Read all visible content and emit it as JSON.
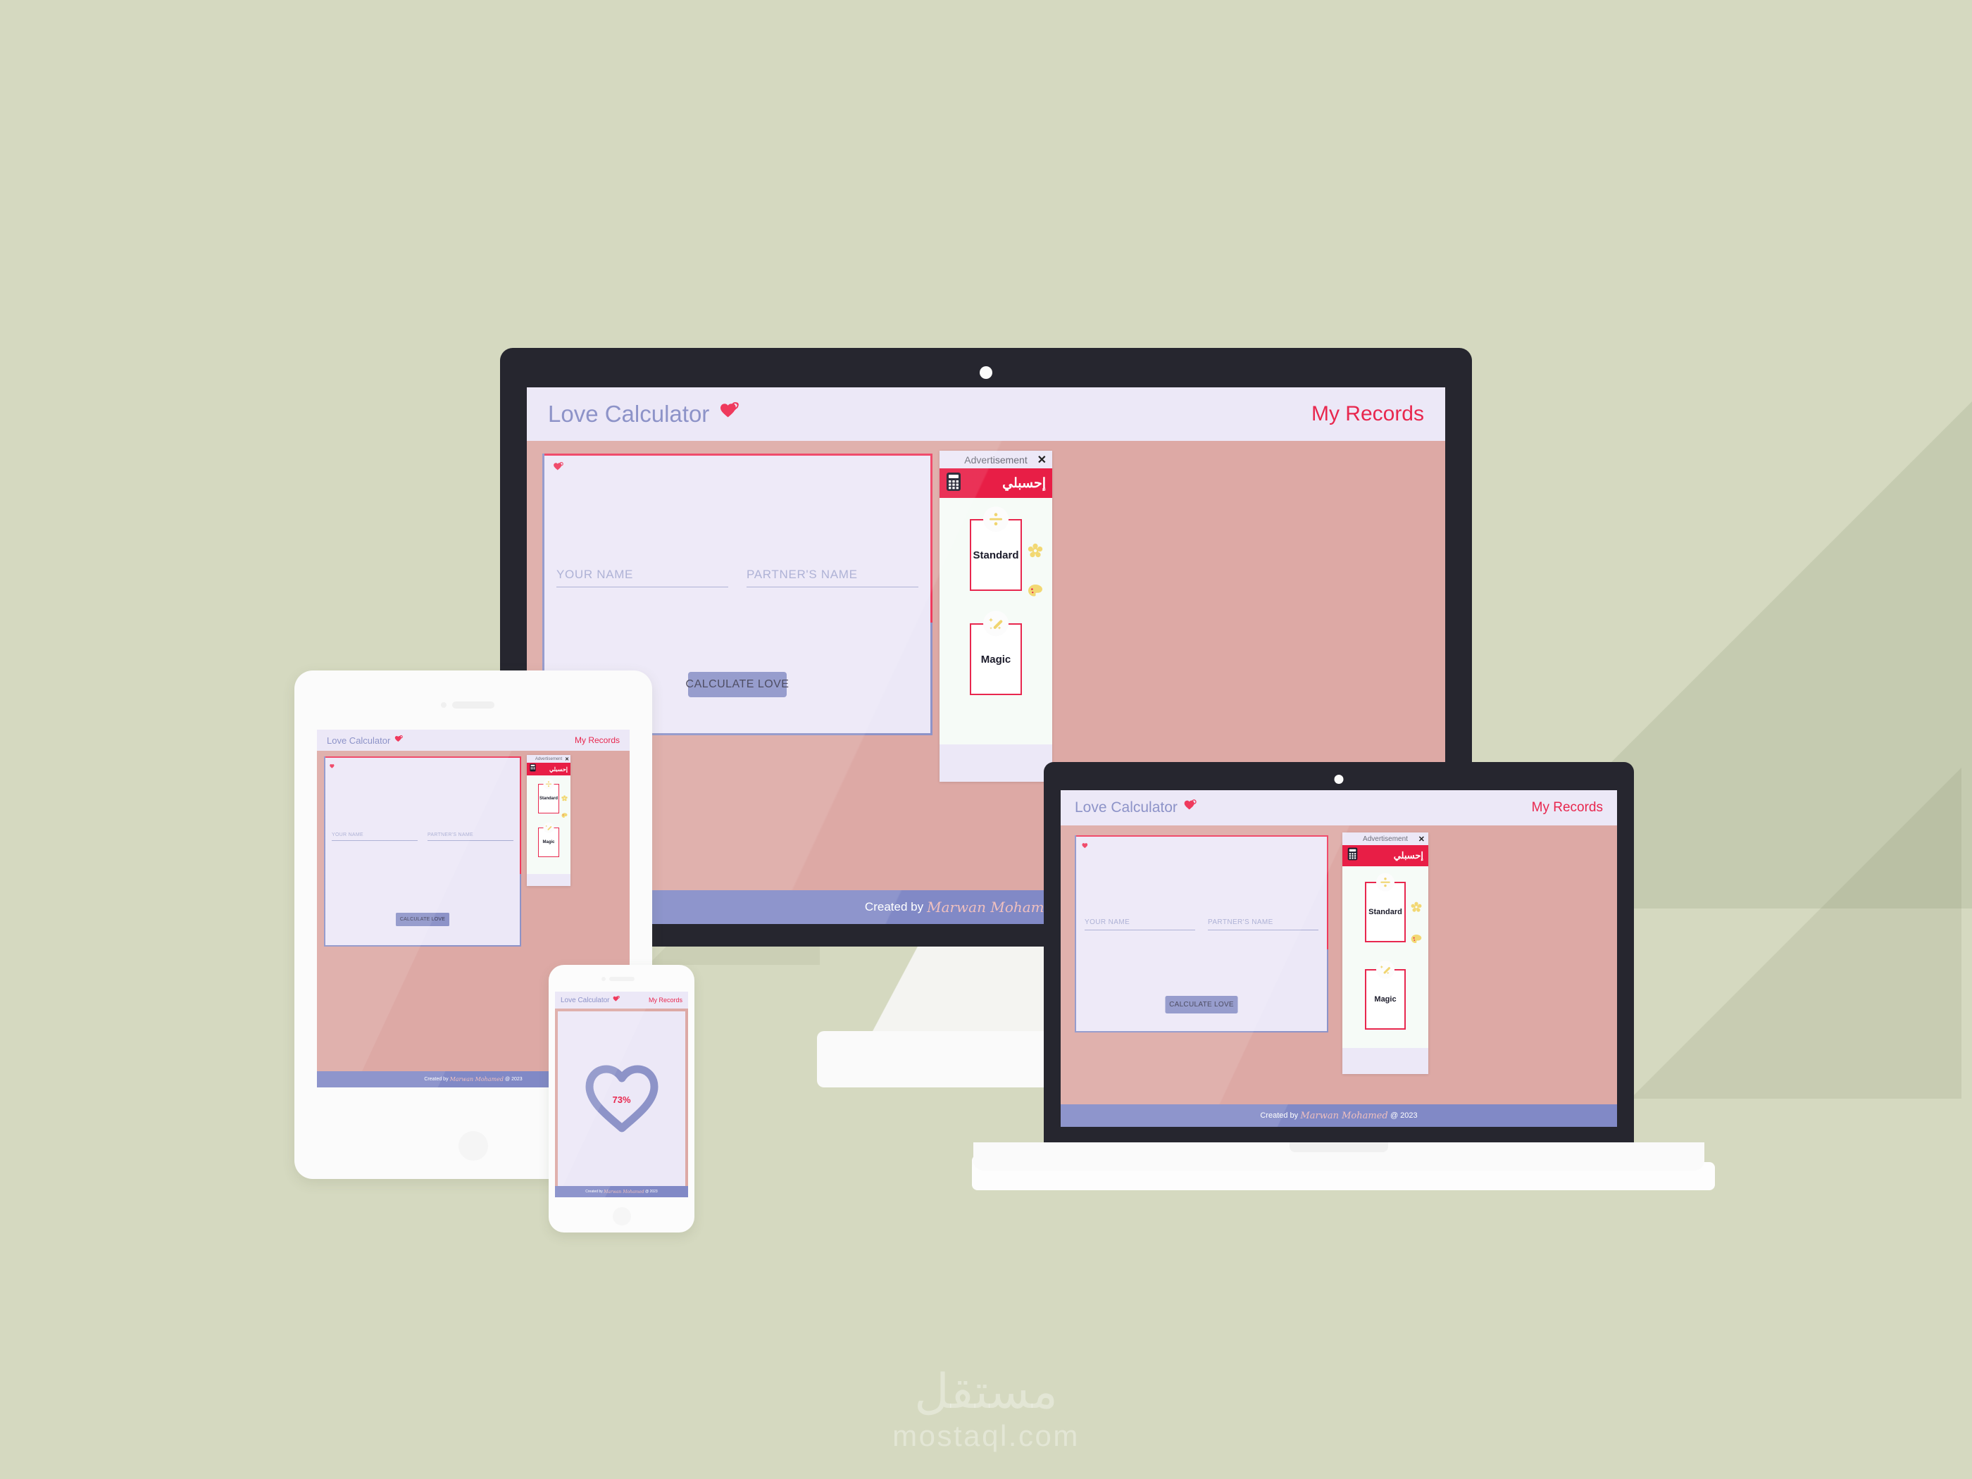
{
  "background_color": "#d5d9c0",
  "colors": {
    "accent_red": "#e8274e",
    "lavender": "#ece8f7",
    "periwinkle": "#8d93c8",
    "rose": "#dda9a5",
    "footer": "#8189c6",
    "ad_brand_red": "#e81e46",
    "icon_yellow": "#f2d873"
  },
  "app": {
    "title": "Love Calculator",
    "title_icon": "double-heart-icon",
    "records_link": "My Records",
    "card_heart_icon": "double-heart-icon",
    "fields": [
      {
        "label": "YOUR NAME",
        "value": "",
        "placeholder": "YOUR NAME"
      },
      {
        "label": "PARTNER'S NAME",
        "value": "",
        "placeholder": "PARTNER'S NAME"
      }
    ],
    "calculate_button": "CALCULATE LOVE",
    "footer": {
      "prefix": "Created by",
      "author": "Marwan Mohamed",
      "suffix": "@ 2023"
    },
    "result": {
      "percent": "73%",
      "value": 73,
      "icon": "heart-outline-icon"
    }
  },
  "advertisement": {
    "header_title": "Advertisement",
    "close_icon": "close-icon",
    "brand_name": "إحسبلي",
    "brand_icon": "calculator-icon",
    "cards": [
      {
        "label": "Standard",
        "icon": "division-sign-icon"
      },
      {
        "label": "Magic",
        "icon": "magic-wand-icon"
      }
    ],
    "side_icons": [
      {
        "name": "flower-icon"
      },
      {
        "name": "palette-icon"
      }
    ]
  },
  "devices": [
    {
      "name": "desktop-monitor"
    },
    {
      "name": "tablet"
    },
    {
      "name": "smartphone"
    },
    {
      "name": "laptop"
    }
  ],
  "watermark": {
    "arabic": "مستقل",
    "latin": "mostaql.com"
  }
}
